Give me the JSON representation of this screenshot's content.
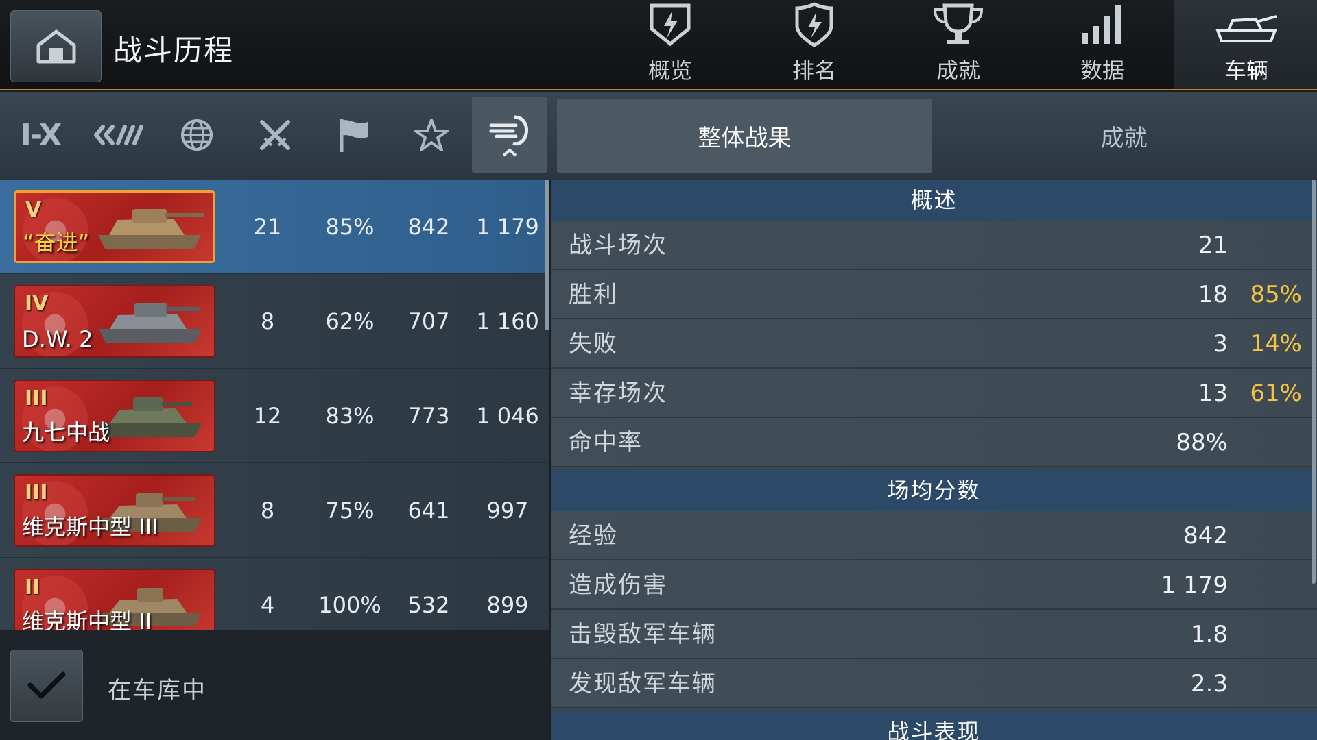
{
  "header": {
    "title": "战斗历程",
    "tabs": [
      {
        "label": "概览",
        "icon": "shield-bolt-icon"
      },
      {
        "label": "排名",
        "icon": "badge-bolt-icon"
      },
      {
        "label": "成就",
        "icon": "trophy-icon"
      },
      {
        "label": "数据",
        "icon": "bar-signal-icon"
      },
      {
        "label": "车辆",
        "icon": "tank-icon",
        "active": true
      }
    ]
  },
  "filters": {
    "tier_label": "I-X",
    "icons": [
      "tier-filter",
      "vehicle-class-icon",
      "globe-icon",
      "crossed-swords-icon",
      "flag-icon",
      "star-icon",
      "sort-icon"
    ],
    "subtabs": [
      {
        "label": "整体战果",
        "active": true
      },
      {
        "label": "成就",
        "active": false
      }
    ]
  },
  "vehicles": [
    {
      "tier": "V",
      "name": "“奋进”",
      "battles": "21",
      "winrate": "85%",
      "avg_xp": "842",
      "avg_dmg": "1 179",
      "selected": true
    },
    {
      "tier": "IV",
      "name": "D.W. 2",
      "battles": "8",
      "winrate": "62%",
      "avg_xp": "707",
      "avg_dmg": "1 160",
      "selected": false
    },
    {
      "tier": "III",
      "name": "九七中战",
      "battles": "12",
      "winrate": "83%",
      "avg_xp": "773",
      "avg_dmg": "1 046",
      "selected": false
    },
    {
      "tier": "III",
      "name": "维克斯中型 III",
      "battles": "8",
      "winrate": "75%",
      "avg_xp": "641",
      "avg_dmg": "997",
      "selected": false
    },
    {
      "tier": "II",
      "name": "维克斯中型 II",
      "battles": "4",
      "winrate": "100%",
      "avg_xp": "532",
      "avg_dmg": "899",
      "selected": false
    }
  ],
  "garage_filter": {
    "label": "在车库中",
    "checked": true
  },
  "stats": {
    "overview_title": "概述",
    "overview": [
      {
        "label": "战斗场次",
        "value": "21",
        "pct": ""
      },
      {
        "label": "胜利",
        "value": "18",
        "pct": "85%"
      },
      {
        "label": "失败",
        "value": "3",
        "pct": "14%"
      },
      {
        "label": "幸存场次",
        "value": "13",
        "pct": "61%"
      },
      {
        "label": "命中率",
        "value": "88%",
        "pct": ""
      }
    ],
    "avg_title": "场均分数",
    "avg": [
      {
        "label": "经验",
        "value": "842"
      },
      {
        "label": "造成伤害",
        "value": "1 179"
      },
      {
        "label": "击毁敌军车辆",
        "value": "1.8"
      },
      {
        "label": "发现敌军车辆",
        "value": "2.3"
      }
    ],
    "performance_title": "战斗表现"
  },
  "colors": {
    "accent": "#c8852a",
    "highlight_pct": "#f5c342",
    "selected_row": "#3b6e9e",
    "card_red": "#c32e2a"
  }
}
